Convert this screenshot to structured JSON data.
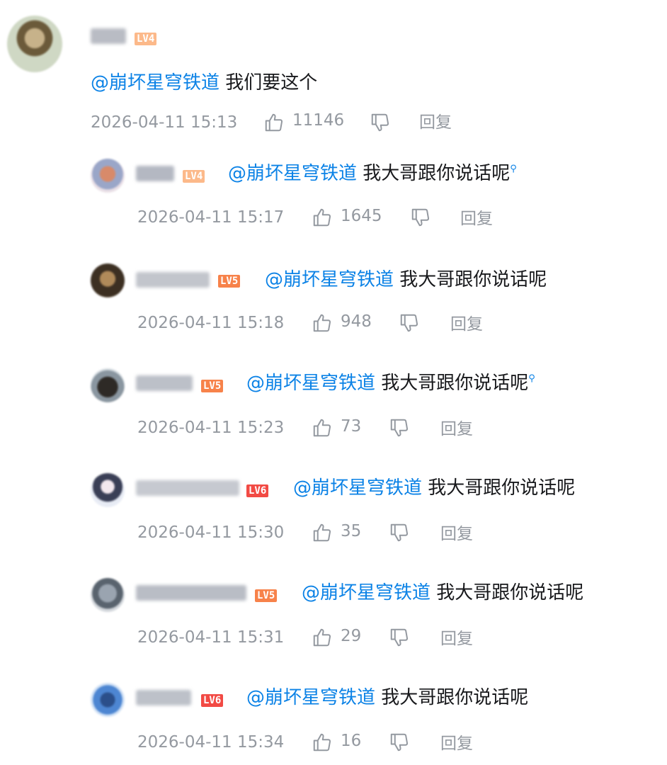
{
  "colors": {
    "mention": "#0b82e6",
    "text": "#18191c",
    "meta": "#9499a0",
    "lv4": "#fcb98a",
    "lv5": "#f7824a",
    "lv6": "#f24a44"
  },
  "icons": {
    "like": "thumbs-up-icon",
    "dislike": "thumbs-down-icon",
    "search": "search-icon"
  },
  "main_comment": {
    "level": "LV4",
    "mention": "@崩坏星穹铁道",
    "content": "我们要这个",
    "time": "2026-04-11 15:13",
    "likes": "11146",
    "reply_label": "回复"
  },
  "replies": [
    {
      "level": "LV4",
      "mention": "@崩坏星穹铁道",
      "content": "我大哥跟你说话呢",
      "time": "2026-04-11 15:17",
      "likes": "1645",
      "reply_label": "回复"
    },
    {
      "level": "LV5",
      "mention": "@崩坏星穹铁道",
      "content": "我大哥跟你说话呢",
      "time": "2026-04-11 15:18",
      "likes": "948",
      "reply_label": "回复"
    },
    {
      "level": "LV5",
      "mention": "@崩坏星穹铁道",
      "content": "我大哥跟你说话呢",
      "time": "2026-04-11 15:23",
      "likes": "73",
      "reply_label": "回复"
    },
    {
      "level": "LV6",
      "mention": "@崩坏星穹铁道",
      "content": "我大哥跟你说话呢",
      "time": "2026-04-11 15:30",
      "likes": "35",
      "reply_label": "回复"
    },
    {
      "level": "LV5",
      "mention": "@崩坏星穹铁道",
      "content": "我大哥跟你说话呢",
      "time": "2026-04-11 15:31",
      "likes": "29",
      "reply_label": "回复"
    },
    {
      "level": "LV6",
      "mention": "@崩坏星穹铁道",
      "content": "我大哥跟你说话呢",
      "time": "2026-04-11 15:34",
      "likes": "16",
      "reply_label": "回复"
    }
  ]
}
